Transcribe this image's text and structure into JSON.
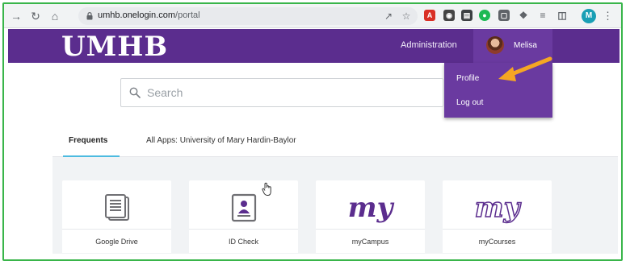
{
  "browser": {
    "url_host": "umhb.onelogin.com",
    "url_path": "/portal",
    "profile_initial": "M"
  },
  "header": {
    "logo": "UMHB",
    "admin_link": "Administration",
    "user_name": "Melisa"
  },
  "user_menu": {
    "items": [
      {
        "label": "Profile"
      },
      {
        "label": "Log out"
      }
    ]
  },
  "search": {
    "placeholder": "Search"
  },
  "tabs": [
    {
      "label": "Frequents",
      "active": true
    },
    {
      "label": "All Apps: University of Mary Hardin-Baylor",
      "active": false
    }
  ],
  "apps": [
    {
      "label": "Google Drive",
      "icon": "document-stack-icon"
    },
    {
      "label": "ID Check",
      "icon": "id-card-icon"
    },
    {
      "label": "myCampus",
      "icon": "my-logo-icon",
      "logo_text": "my"
    },
    {
      "label": "myCourses",
      "icon": "my-outline-logo-icon",
      "logo_text": "my"
    }
  ],
  "colors": {
    "brand_purple": "#5b2d8e",
    "menu_purple": "#6a3aa0",
    "active_tab_underline": "#4dbbe0",
    "annotation_arrow": "#f5a623",
    "frame_border": "#39b54a"
  }
}
